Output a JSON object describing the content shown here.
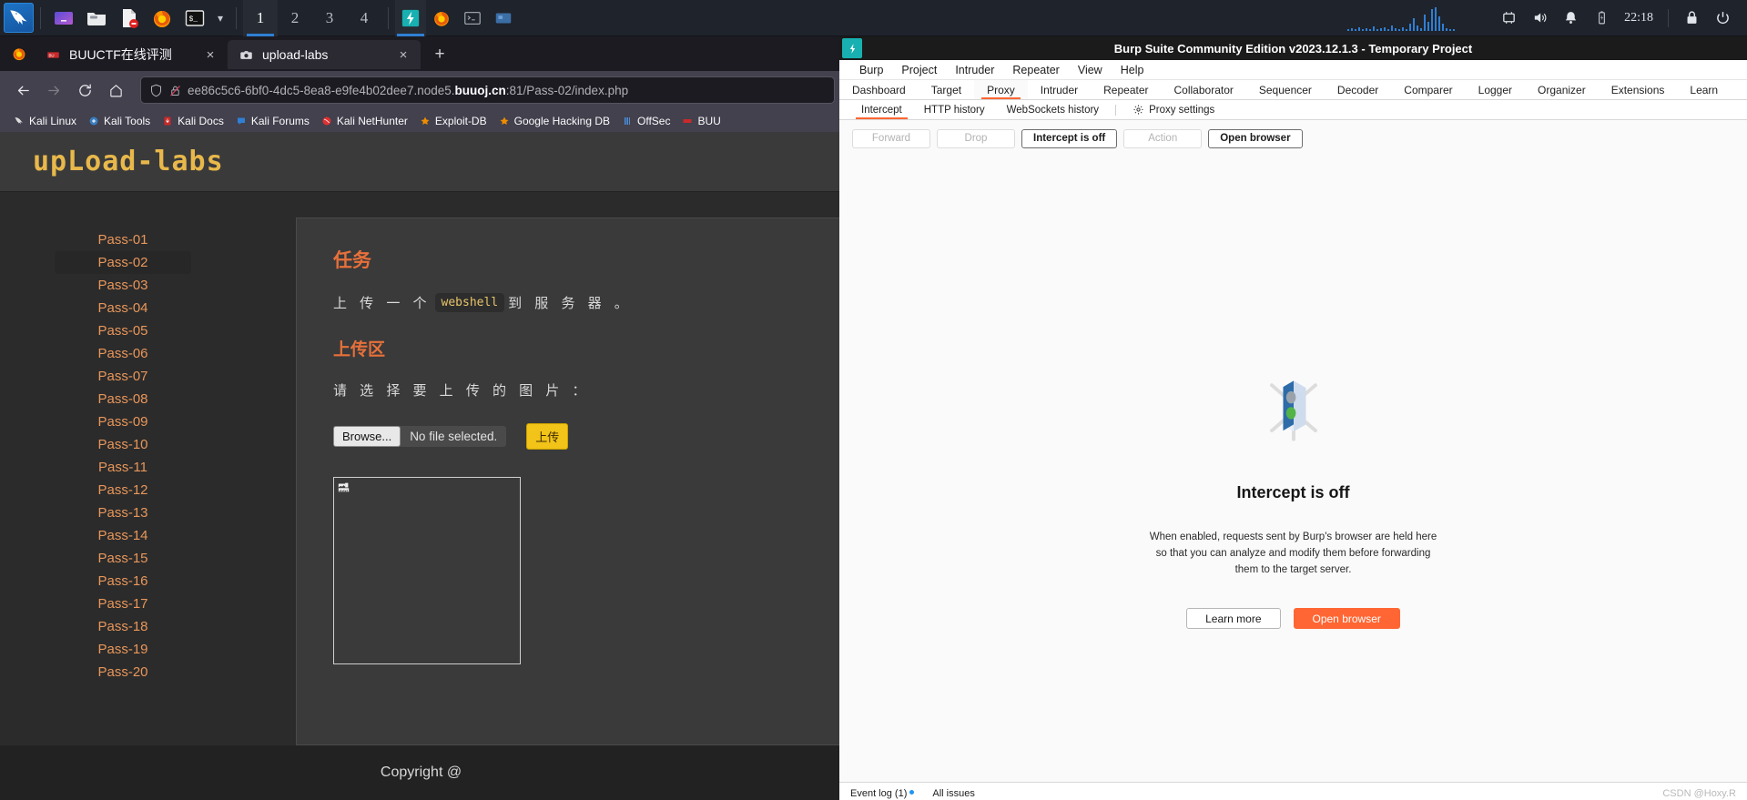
{
  "taskbar": {
    "apps": [
      {
        "name": "kali-menu-icon",
        "label": "Kali Linux Menu"
      },
      {
        "name": "files-manager-icon",
        "label": "File Manager"
      },
      {
        "name": "folder-icon",
        "label": "Folder"
      },
      {
        "name": "text-editor-icon",
        "label": "Text Editor"
      },
      {
        "name": "firefox-icon",
        "label": "Firefox ESR"
      },
      {
        "name": "terminal-icon",
        "label": "Terminal"
      }
    ],
    "workspaces": [
      "1",
      "2",
      "3",
      "4"
    ],
    "active_workspace": "1",
    "window_buttons": [
      "burp-suite",
      "firefox",
      "terminal",
      "file-manager"
    ],
    "active_window": "burp-suite",
    "tray": {
      "time": "22:18",
      "icons": [
        "network-icon",
        "volume-icon",
        "notification-bell-icon",
        "battery-icon",
        "lock-icon",
        "power-icon"
      ]
    }
  },
  "firefox": {
    "tabs": [
      {
        "title": "BUUCTF在线评测",
        "favicon": "buuctf-favicon",
        "selected": false
      },
      {
        "title": "upload-labs",
        "favicon": "camera-favicon",
        "selected": true
      }
    ],
    "new_tab_label": "+",
    "close_label": "×",
    "nav": {
      "back": "←",
      "forward": "→",
      "reload": "⟳",
      "home": "⌂"
    },
    "url": {
      "prefix": "ee86c5c6-6bf0-4dc5-8ea8-e9fe4b02dee7.node5.",
      "domain": "buuoj.cn",
      "suffix": ":81/Pass-02/index.php",
      "full": "ee86c5c6-6bf0-4dc5-8ea8-e9fe4b02dee7.node5.buuoj.cn:81/Pass-02/index.php"
    },
    "bookmarks": [
      {
        "label": "Kali Linux",
        "icon": "kali-dragon-icon"
      },
      {
        "label": "Kali Tools",
        "icon": "kali-tools-icon"
      },
      {
        "label": "Kali Docs",
        "icon": "kali-docs-icon"
      },
      {
        "label": "Kali Forums",
        "icon": "kali-forums-icon"
      },
      {
        "label": "Kali NetHunter",
        "icon": "kali-nethunter-icon"
      },
      {
        "label": "Exploit-DB",
        "icon": "exploit-db-icon"
      },
      {
        "label": "Google Hacking DB",
        "icon": "google-hacking-db-icon"
      },
      {
        "label": "OffSec",
        "icon": "offsec-icon"
      },
      {
        "label": "BUU",
        "icon": "buuctf-icon"
      }
    ]
  },
  "page": {
    "logo": "upLoad-labs",
    "passes": [
      "Pass-01",
      "Pass-02",
      "Pass-03",
      "Pass-04",
      "Pass-05",
      "Pass-06",
      "Pass-07",
      "Pass-08",
      "Pass-09",
      "Pass-10",
      "Pass-11",
      "Pass-12",
      "Pass-13",
      "Pass-14",
      "Pass-15",
      "Pass-16",
      "Pass-17",
      "Pass-18",
      "Pass-19",
      "Pass-20"
    ],
    "active_pass": "Pass-02",
    "task_heading": "任务",
    "task_text_before": "上 传 一 个",
    "task_code": "webshell",
    "task_text_after": "到 服 务 器 。",
    "upload_heading": "上传区",
    "upload_prompt": "请 选 择 要 上 传 的 图 片 ：",
    "browse_label": "Browse...",
    "no_file_label": "No file selected.",
    "submit_label": "上传",
    "footer": "Copyright @"
  },
  "burp": {
    "window_title": "Burp Suite Community Edition v2023.12.1.3 - Temporary Project",
    "menus": [
      "Burp",
      "Project",
      "Intruder",
      "Repeater",
      "View",
      "Help"
    ],
    "tabs": [
      "Dashboard",
      "Target",
      "Proxy",
      "Intruder",
      "Repeater",
      "Collaborator",
      "Sequencer",
      "Decoder",
      "Comparer",
      "Logger",
      "Organizer",
      "Extensions",
      "Learn"
    ],
    "active_tab": "Proxy",
    "subtabs": [
      "Intercept",
      "HTTP history",
      "WebSockets history"
    ],
    "active_subtab": "Intercept",
    "proxy_settings_label": "Proxy settings",
    "buttons": [
      {
        "label": "Forward",
        "enabled": false
      },
      {
        "label": "Drop",
        "enabled": false
      },
      {
        "label": "Intercept is off",
        "enabled": true
      },
      {
        "label": "Action",
        "enabled": false
      },
      {
        "label": "Open browser",
        "enabled": true
      }
    ],
    "empty_state": {
      "heading": "Intercept is off",
      "description": "When enabled, requests sent by Burp's browser are held here so that you can analyze and modify them before forwarding them to the target server.",
      "learn_more": "Learn more",
      "open_browser": "Open browser",
      "icon": "traffic-light-icon"
    },
    "status": {
      "event_log": "Event log (1)",
      "all_issues": "All issues",
      "watermark": "CSDN @Hoxy.R"
    },
    "accent_color": "#ff6633"
  }
}
